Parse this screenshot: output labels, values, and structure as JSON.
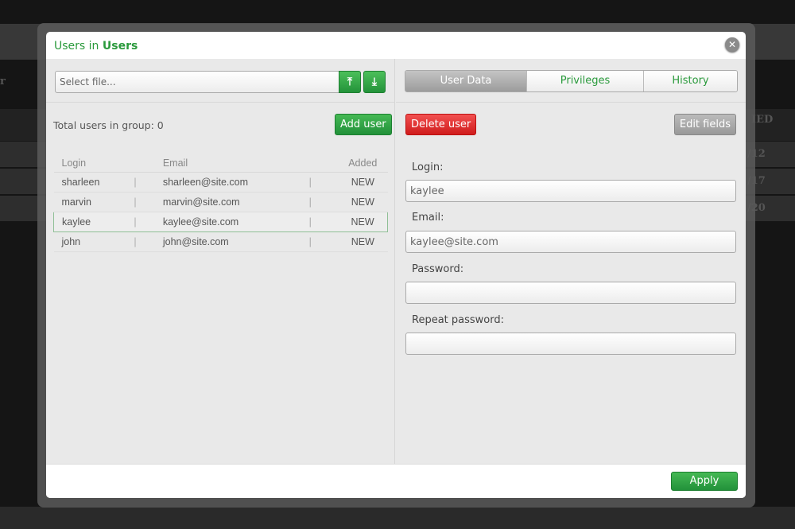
{
  "background": {
    "fragments": [
      "r",
      "IED",
      "/12",
      "/17",
      "/20"
    ]
  },
  "modal": {
    "title_prefix": "Users in",
    "title_group": "Users",
    "close_icon": "close-icon"
  },
  "file": {
    "placeholder": "Select file...",
    "upload_icon": "upload-icon",
    "download_icon": "download-icon"
  },
  "left": {
    "total_label": "Total users in group:",
    "total_value": "0",
    "add_user": "Add user",
    "columns": [
      "Login",
      "Email",
      "Added"
    ],
    "rows": [
      {
        "login": "sharleen",
        "email": "sharleen@site.com",
        "added": "NEW"
      },
      {
        "login": "marvin",
        "email": "marvin@site.com",
        "added": "NEW"
      },
      {
        "login": "kaylee",
        "email": "kaylee@site.com",
        "added": "NEW",
        "selected": true
      },
      {
        "login": "john",
        "email": "john@site.com",
        "added": "NEW"
      }
    ],
    "separator": "|"
  },
  "right": {
    "tabs": [
      "User Data",
      "Privileges",
      "History"
    ],
    "active_tab": "User Data",
    "delete_user": "Delete user",
    "edit_fields": "Edit fields",
    "fields": {
      "login_label": "Login:",
      "login_value": "kaylee",
      "email_label": "Email:",
      "email_value": "kaylee@site.com",
      "password_label": "Password:",
      "password_value": "",
      "repeat_label": "Repeat password:",
      "repeat_value": ""
    }
  },
  "footer": {
    "apply": "Apply"
  },
  "colors": {
    "accent": "#2a9a3c",
    "danger": "#e02a2a"
  }
}
